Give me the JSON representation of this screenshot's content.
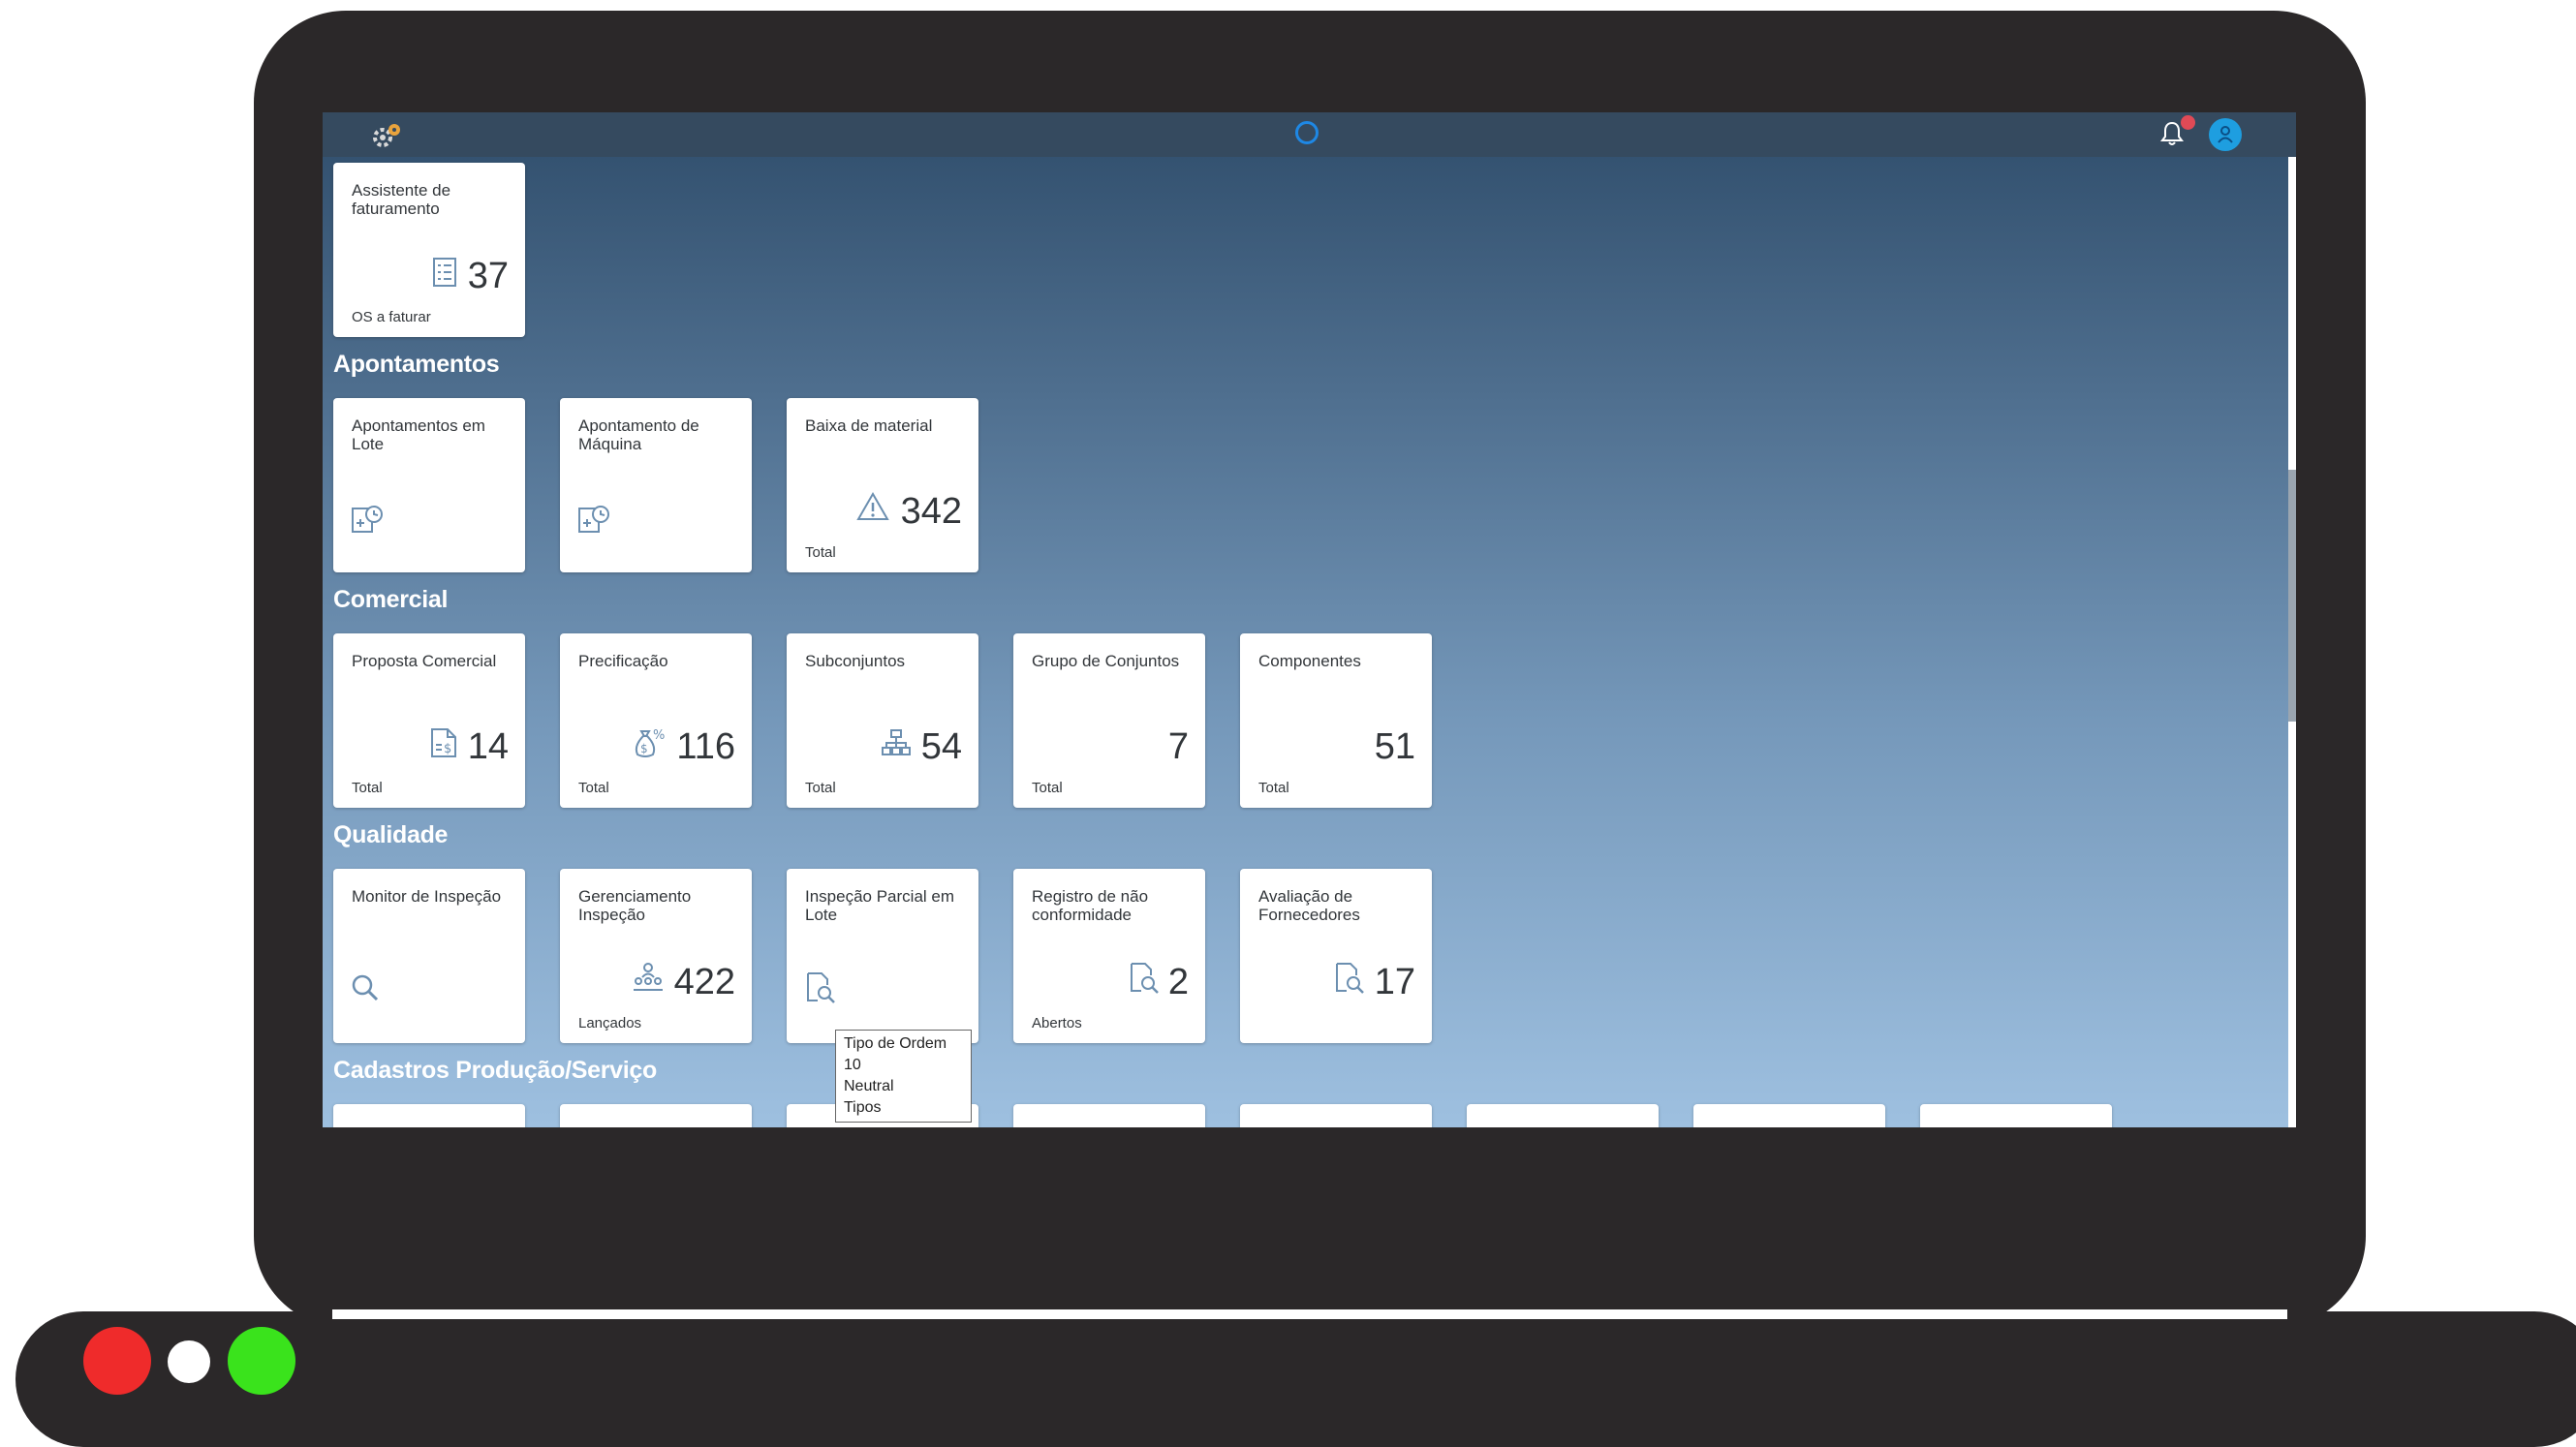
{
  "shellbar": {
    "logo_icon": "company-logo-icon",
    "assistant_icon": "ai-assistant-ring-icon",
    "notifications_icon": "bell-icon",
    "user_icon": "user-avatar-icon"
  },
  "top_tile": {
    "title": "Assistente de faturamento",
    "number": "37",
    "footer": "OS a faturar",
    "icon": "list-icon"
  },
  "sections": {
    "apontamentos": {
      "title": "Apontamentos",
      "tiles": [
        {
          "title": "Apontamentos em Lote",
          "number": "",
          "footer": "",
          "icon": "time-entry-icon"
        },
        {
          "title": "Apontamento de Máquina",
          "number": "",
          "footer": "",
          "icon": "time-entry-icon"
        },
        {
          "title": "Baixa de material",
          "number": "342",
          "footer": "Total",
          "icon": "warning-icon"
        }
      ]
    },
    "comercial": {
      "title": "Comercial",
      "tiles": [
        {
          "title": "Proposta Comercial",
          "number": "14",
          "footer": "Total",
          "icon": "document-money-icon"
        },
        {
          "title": "Precificação",
          "number": "116",
          "footer": "Total",
          "icon": "money-bag-icon"
        },
        {
          "title": "Subconjuntos",
          "number": "54",
          "footer": "Total",
          "icon": "hierarchy-icon"
        },
        {
          "title": "Grupo de Conjuntos",
          "number": "7",
          "footer": "Total",
          "icon": ""
        },
        {
          "title": "Componentes",
          "number": "51",
          "footer": "Total",
          "icon": ""
        }
      ]
    },
    "qualidade": {
      "title": "Qualidade",
      "tiles": [
        {
          "title": "Monitor de Inspeção",
          "number": "",
          "footer": "",
          "icon": "search-icon"
        },
        {
          "title": "Gerenciamento Inspeção",
          "number": "422",
          "footer": "Lançados",
          "icon": "group-icon"
        },
        {
          "title": "Inspeção Parcial em Lote",
          "number": "",
          "footer": "",
          "icon": "inspect-document-icon"
        },
        {
          "title": "Registro de não conformidade",
          "number": "2",
          "footer": "Abertos",
          "icon": "inspect-document-icon"
        },
        {
          "title": "Avaliação de Fornecedores",
          "number": "17",
          "footer": "",
          "icon": "inspect-document-icon"
        }
      ]
    },
    "cadastros": {
      "title": "Cadastros Produção/Serviço"
    }
  },
  "tooltip": {
    "lines": [
      "Tipo de Ordem",
      "10",
      "Neutral",
      "Tipos"
    ]
  },
  "window_controls": {
    "close_color": "#ef2b2b",
    "minimize_color": "#ffffff",
    "maximize_color": "#3ae31c"
  },
  "colors": {
    "shellbar": "#354a5f",
    "accent": "#1e88e5",
    "notification": "#e04a56",
    "icon": "#6c8fb0"
  }
}
